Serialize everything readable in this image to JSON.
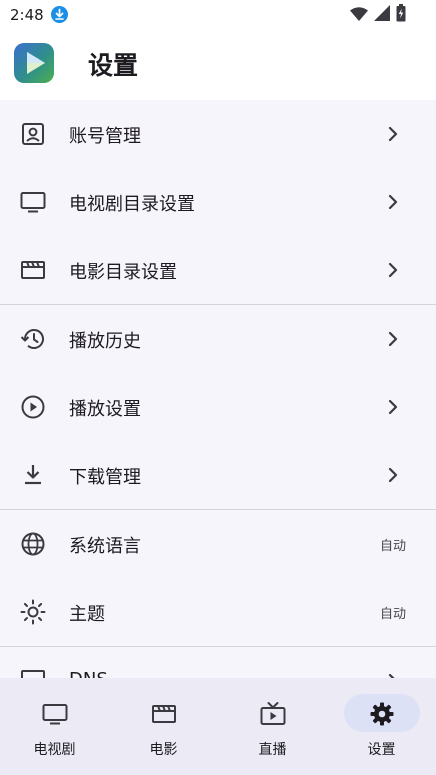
{
  "status_bar": {
    "time": "2:48"
  },
  "header": {
    "title": "设置"
  },
  "settings": {
    "account": {
      "label": "账号管理"
    },
    "tv_dir": {
      "label": "电视剧目录设置"
    },
    "movie_dir": {
      "label": "电影目录设置"
    },
    "history": {
      "label": "播放历史"
    },
    "playback": {
      "label": "播放设置"
    },
    "downloads": {
      "label": "下载管理"
    },
    "language": {
      "label": "系统语言",
      "value": "自动"
    },
    "theme": {
      "label": "主题",
      "value": "自动"
    },
    "dns": {
      "label": "DNS"
    }
  },
  "bottom_nav": {
    "items": [
      {
        "label": "电视剧",
        "icon": "tv-icon"
      },
      {
        "label": "电影",
        "icon": "clapperboard-icon"
      },
      {
        "label": "直播",
        "icon": "live-tv-icon"
      },
      {
        "label": "设置",
        "icon": "gear-icon"
      }
    ],
    "active_index": 3
  },
  "colors": {
    "background": "#f6f5fb",
    "nav_background": "#eceaf4",
    "nav_active_pill": "#dde1f6",
    "divider": "#d6d3dc",
    "download_badge": "#1a8fe8"
  }
}
